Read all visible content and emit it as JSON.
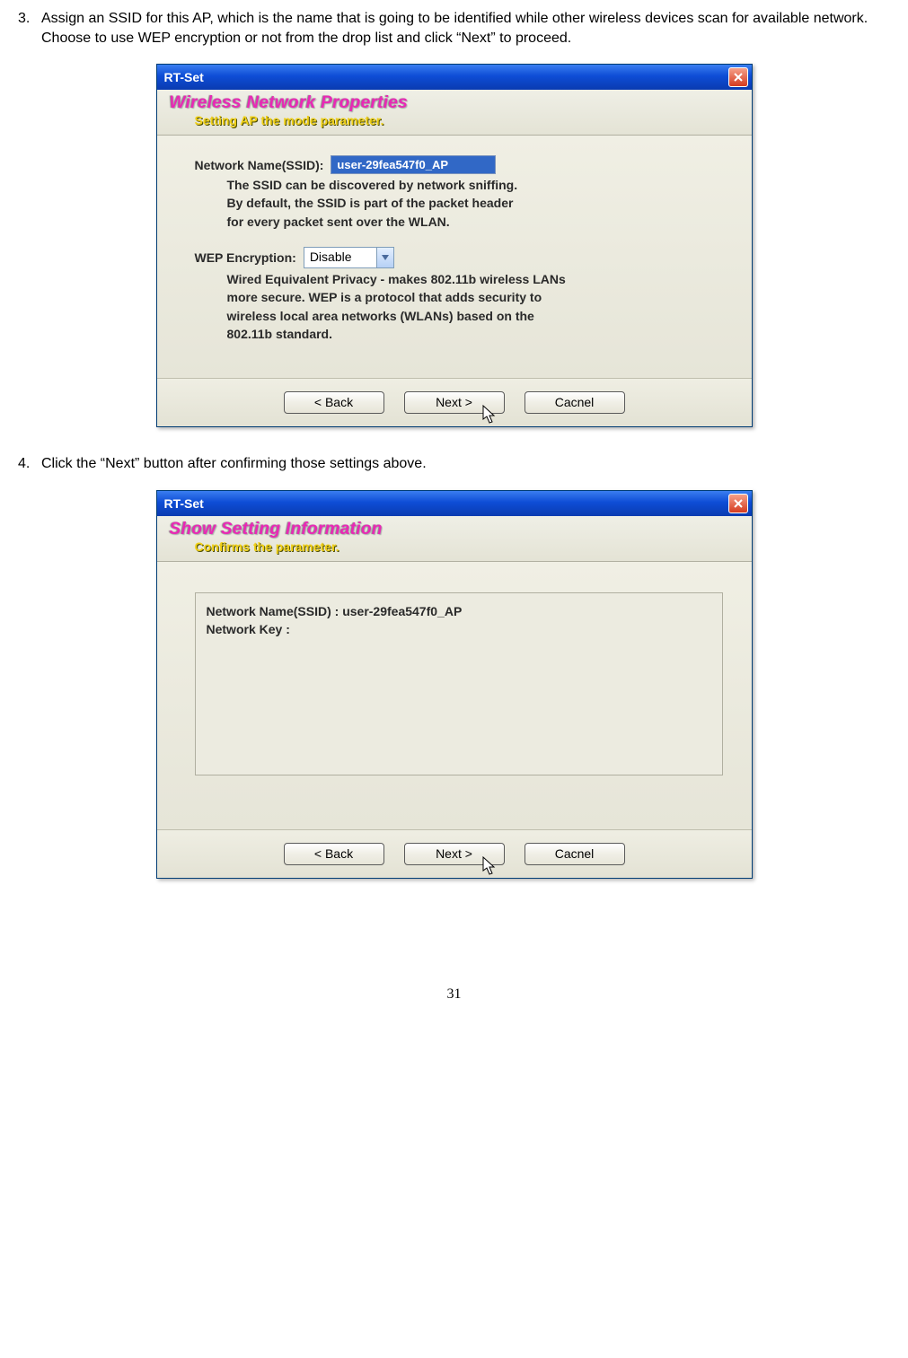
{
  "step3": {
    "num": "3.",
    "text": "Assign an SSID for this AP, which is the name that is going to be identified while other wireless devices scan for available network. Choose to use WEP encryption or not from the drop list and click “Next” to proceed."
  },
  "step4": {
    "num": "4.",
    "text": "Click the “Next” button after confirming those settings above."
  },
  "dialog1": {
    "title": "RT-Set",
    "heading": "Wireless Network Properties",
    "subheading": "Setting AP the mode parameter.",
    "ssid_label": "Network Name(SSID):",
    "ssid_value": "user-29fea547f0_AP",
    "ssid_desc_l1": "The SSID can be discovered by network sniffing.",
    "ssid_desc_l2": "By default, the SSID is part of the packet header",
    "ssid_desc_l3": "for every packet sent over the WLAN.",
    "wep_label": "WEP Encryption:",
    "wep_value": "Disable",
    "wep_desc_l1": "Wired Equivalent Privacy - makes 802.11b wireless LANs",
    "wep_desc_l2": "more secure. WEP is a protocol that adds security to",
    "wep_desc_l3": "wireless local area networks (WLANs) based on the",
    "wep_desc_l4": "802.11b standard.",
    "btn_back": "< Back",
    "btn_next": "Next >",
    "btn_cancel": "Cacnel"
  },
  "dialog2": {
    "title": "RT-Set",
    "heading": "Show Setting Information",
    "subheading": "Confirms the parameter.",
    "summary_l1": "Network Name(SSID) : user-29fea547f0_AP",
    "summary_l2": "Network Key :",
    "btn_back": "< Back",
    "btn_next": "Next >",
    "btn_cancel": "Cacnel"
  },
  "page_number": "31"
}
